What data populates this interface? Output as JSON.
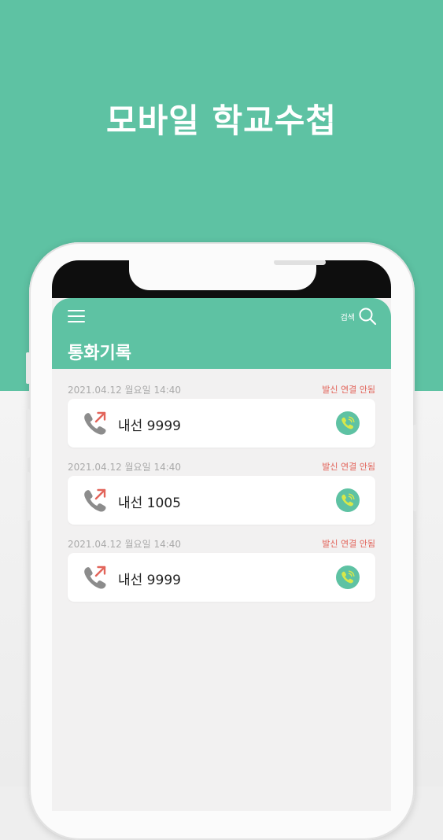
{
  "banner": {
    "title": "모바일 학교수첩"
  },
  "app": {
    "search_label": "검색",
    "page_title": "통화기록"
  },
  "calls": [
    {
      "datetime": "2021.04.12 월요일 14:40",
      "status": "발신 연결 안됨",
      "label": "내선 9999"
    },
    {
      "datetime": "2021.04.12 월요일 14:40",
      "status": "발신 연결 안됨",
      "label": "내선 1005"
    },
    {
      "datetime": "2021.04.12 월요일 14:40",
      "status": "발신 연결 안됨",
      "label": "내선 9999"
    }
  ],
  "colors": {
    "brand": "#5ec2a3",
    "status": "#e2645a",
    "phone_icon": "#8c8c8c",
    "arrow": "#e2645a",
    "dial_icon": "#d8e84a"
  },
  "icons": {
    "menu": "hamburger-menu-icon",
    "search": "search-icon",
    "outgoing_call": "outgoing-call-icon",
    "dial": "phone-ringing-icon"
  }
}
